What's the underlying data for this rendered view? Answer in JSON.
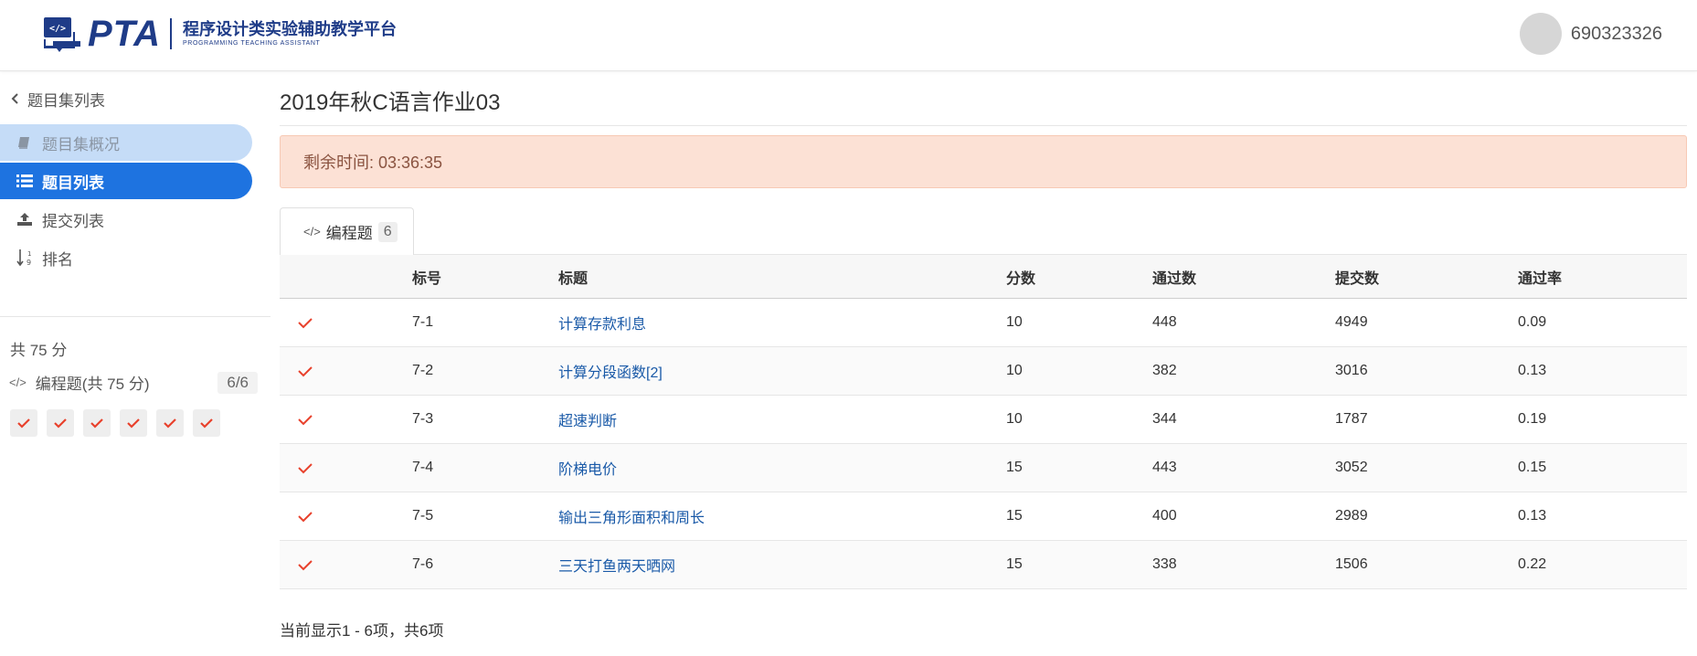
{
  "header": {
    "logo_pta": "PTA",
    "logo_cn": "程序设计类实验辅助教学平台",
    "logo_en": "PROGRAMMING TEACHING ASSISTANT",
    "username": "690323326",
    "brand_color": "#1f3c88"
  },
  "sidebar": {
    "back_label": "题目集列表",
    "items": [
      {
        "label": "题目集概况",
        "icon": "book-icon",
        "state": "hover"
      },
      {
        "label": "题目列表",
        "icon": "list-icon",
        "state": "active"
      },
      {
        "label": "提交列表",
        "icon": "upload-icon",
        "state": "normal"
      },
      {
        "label": "排名",
        "icon": "sort-icon",
        "state": "normal"
      }
    ],
    "total_label": "共 75 分",
    "programming_label": "编程题(共 75 分)",
    "programming_count": "6/6",
    "solved_checks": 6,
    "active_color": "#1e73e0"
  },
  "main": {
    "title": "2019年秋C语言作业03",
    "timer_label": "剩余时间: 03:36:35",
    "tab_label": "编程题",
    "tab_count": "6",
    "columns": [
      "标号",
      "标题",
      "分数",
      "通过数",
      "提交数",
      "通过率"
    ],
    "rows": [
      {
        "id": "7-1",
        "title": "计算存款利息",
        "score": "10",
        "passed": "448",
        "submitted": "4949",
        "rate": "0.09"
      },
      {
        "id": "7-2",
        "title": "计算分段函数[2]",
        "score": "10",
        "passed": "382",
        "submitted": "3016",
        "rate": "0.13"
      },
      {
        "id": "7-3",
        "title": "超速判断",
        "score": "10",
        "passed": "344",
        "submitted": "1787",
        "rate": "0.19"
      },
      {
        "id": "7-4",
        "title": "阶梯电价",
        "score": "15",
        "passed": "443",
        "submitted": "3052",
        "rate": "0.15"
      },
      {
        "id": "7-5",
        "title": "输出三角形面积和周长",
        "score": "15",
        "passed": "400",
        "submitted": "2989",
        "rate": "0.13"
      },
      {
        "id": "7-6",
        "title": "三天打鱼两天晒网",
        "score": "15",
        "passed": "338",
        "submitted": "1506",
        "rate": "0.22"
      }
    ],
    "footer": "当前显示1 - 6项，共6项",
    "check_color": "#e8412c"
  }
}
